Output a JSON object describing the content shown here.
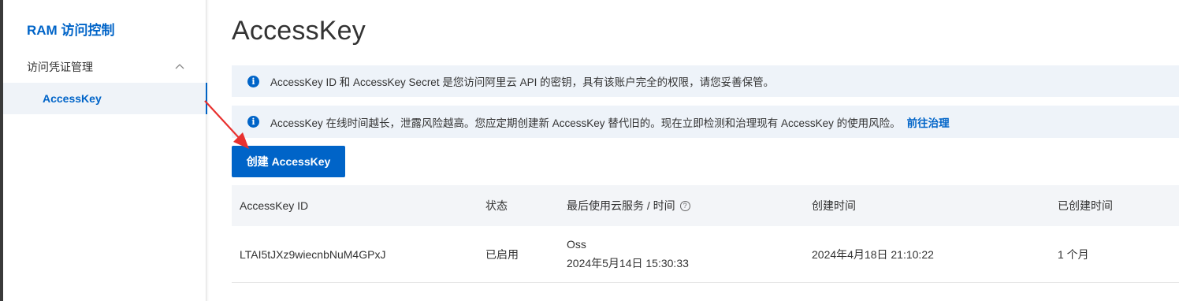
{
  "sidebar": {
    "brand": "RAM 访问控制",
    "group_label": "访问凭证管理",
    "active_item": "AccessKey"
  },
  "main": {
    "title": "AccessKey",
    "notice1": "AccessKey ID 和 AccessKey Secret 是您访问阿里云 API 的密钥，具有该账户完全的权限，请您妥善保管。",
    "notice2": "AccessKey 在线时间越长，泄露风险越高。您应定期创建新 AccessKey 替代旧的。现在立即检测和治理现有 AccessKey 的使用风险。",
    "notice2_link": "前往治理",
    "create_button": "创建 AccessKey"
  },
  "table": {
    "headers": [
      "AccessKey ID",
      "状态",
      "最后使用云服务 / 时间",
      "创建时间",
      "已创建时间"
    ],
    "rows": [
      {
        "id": "LTAI5tJXz9wiecnbNuM4GPxJ",
        "status": "已启用",
        "last_service": "Oss",
        "last_time": "2024年5月14日 15:30:33",
        "created": "2024年4月18日 21:10:22",
        "age": "1 个月"
      }
    ]
  },
  "colors": {
    "accent": "#0064c8",
    "annotation_arrow": "#e8312f"
  },
  "icons": [
    "chevron-up-icon",
    "info-icon",
    "help-icon"
  ]
}
